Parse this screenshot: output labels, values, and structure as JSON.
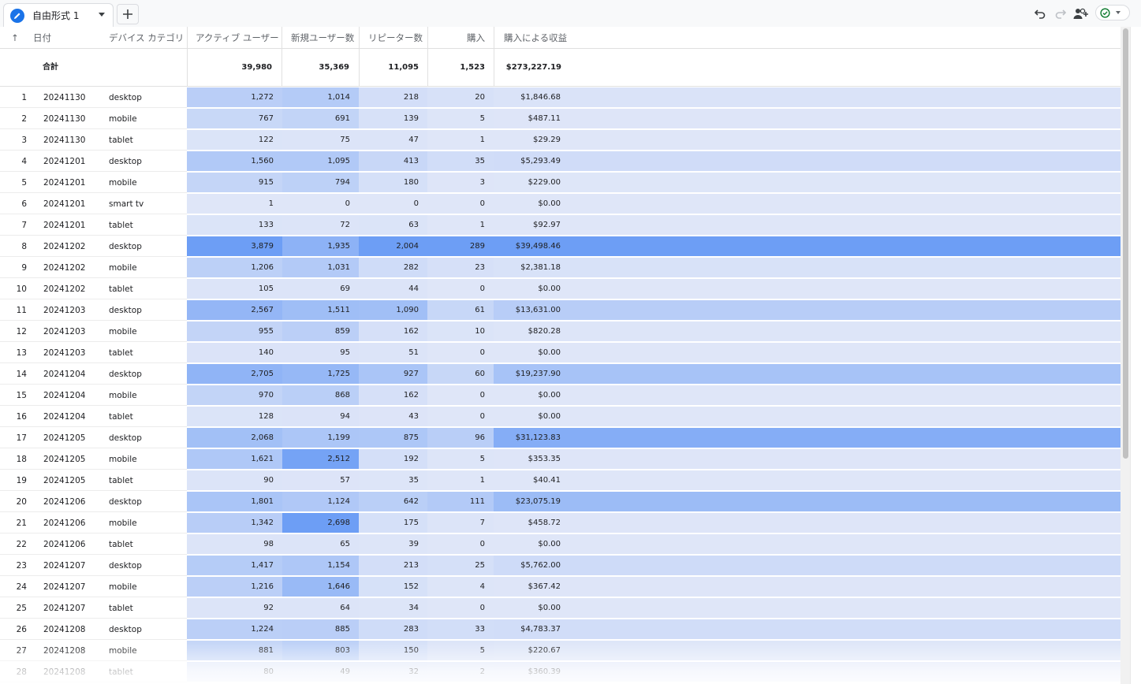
{
  "tab": {
    "label": "自由形式 1",
    "add_symbol": "+"
  },
  "toolbar": {
    "icons": [
      "undo-icon",
      "redo-icon",
      "share-icon",
      "status-check-icon"
    ]
  },
  "table": {
    "sort_indicator": "↑",
    "columns": [
      "日付",
      "デバイス カテゴリ",
      "アクティブ ユーザー",
      "新規ユーザー数",
      "リピーター数",
      "購入",
      "購入による収益"
    ],
    "totals": {
      "label": "合計",
      "values": [
        "39,980",
        "35,369",
        "11,095",
        "1,523",
        "$273,227.19"
      ]
    },
    "rows": [
      [
        "1",
        "20241130",
        "desktop",
        "1,272",
        "1,014",
        "218",
        "20",
        "$1,846.68"
      ],
      [
        "2",
        "20241130",
        "mobile",
        "767",
        "691",
        "139",
        "5",
        "$487.11"
      ],
      [
        "3",
        "20241130",
        "tablet",
        "122",
        "75",
        "47",
        "1",
        "$29.29"
      ],
      [
        "4",
        "20241201",
        "desktop",
        "1,560",
        "1,095",
        "413",
        "35",
        "$5,293.49"
      ],
      [
        "5",
        "20241201",
        "mobile",
        "915",
        "794",
        "180",
        "3",
        "$229.00"
      ],
      [
        "6",
        "20241201",
        "smart tv",
        "1",
        "0",
        "0",
        "0",
        "$0.00"
      ],
      [
        "7",
        "20241201",
        "tablet",
        "133",
        "72",
        "63",
        "1",
        "$92.97"
      ],
      [
        "8",
        "20241202",
        "desktop",
        "3,879",
        "1,935",
        "2,004",
        "289",
        "$39,498.46"
      ],
      [
        "9",
        "20241202",
        "mobile",
        "1,206",
        "1,031",
        "282",
        "23",
        "$2,381.18"
      ],
      [
        "10",
        "20241202",
        "tablet",
        "105",
        "69",
        "44",
        "0",
        "$0.00"
      ],
      [
        "11",
        "20241203",
        "desktop",
        "2,567",
        "1,511",
        "1,090",
        "61",
        "$13,631.00"
      ],
      [
        "12",
        "20241203",
        "mobile",
        "955",
        "859",
        "162",
        "10",
        "$820.28"
      ],
      [
        "13",
        "20241203",
        "tablet",
        "140",
        "95",
        "51",
        "0",
        "$0.00"
      ],
      [
        "14",
        "20241204",
        "desktop",
        "2,705",
        "1,725",
        "927",
        "60",
        "$19,237.90"
      ],
      [
        "15",
        "20241204",
        "mobile",
        "970",
        "868",
        "162",
        "0",
        "$0.00"
      ],
      [
        "16",
        "20241204",
        "tablet",
        "128",
        "94",
        "43",
        "0",
        "$0.00"
      ],
      [
        "17",
        "20241205",
        "desktop",
        "2,068",
        "1,199",
        "875",
        "96",
        "$31,123.83"
      ],
      [
        "18",
        "20241205",
        "mobile",
        "1,621",
        "2,512",
        "192",
        "5",
        "$353.35"
      ],
      [
        "19",
        "20241205",
        "tablet",
        "90",
        "57",
        "35",
        "1",
        "$40.41"
      ],
      [
        "20",
        "20241206",
        "desktop",
        "1,801",
        "1,124",
        "642",
        "111",
        "$23,075.19"
      ],
      [
        "21",
        "20241206",
        "mobile",
        "1,342",
        "2,698",
        "175",
        "7",
        "$458.72"
      ],
      [
        "22",
        "20241206",
        "tablet",
        "98",
        "65",
        "39",
        "0",
        "$0.00"
      ],
      [
        "23",
        "20241207",
        "desktop",
        "1,417",
        "1,154",
        "213",
        "25",
        "$5,762.00"
      ],
      [
        "24",
        "20241207",
        "mobile",
        "1,216",
        "1,646",
        "152",
        "4",
        "$367.42"
      ],
      [
        "25",
        "20241207",
        "tablet",
        "92",
        "64",
        "34",
        "0",
        "$0.00"
      ],
      [
        "26",
        "20241208",
        "desktop",
        "1,224",
        "885",
        "283",
        "33",
        "$4,783.37"
      ],
      [
        "27",
        "20241208",
        "mobile",
        "881",
        "803",
        "150",
        "5",
        "$220.67"
      ],
      [
        "28",
        "20241208",
        "tablet",
        "80",
        "49",
        "32",
        "2",
        "$360.39"
      ]
    ]
  },
  "colors": {
    "heat_base": "#dfe6f8",
    "heat_max": "#6d9ef5",
    "accent": "#1a73e8",
    "check": "#188038"
  }
}
